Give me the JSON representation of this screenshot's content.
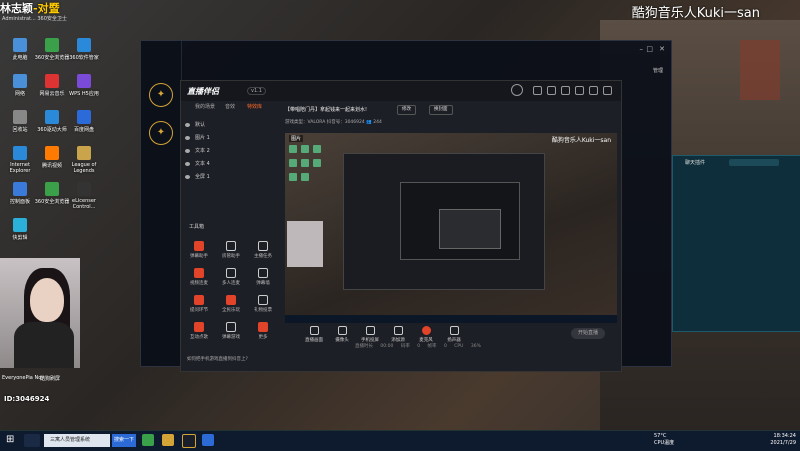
{
  "overlay": {
    "stream_title_prefix": "林志颖",
    "stream_title_suffix": "-对暨",
    "admin_label": "Administrat...  360安全卫士",
    "streamer_name": "酷狗音乐人Kuki一san",
    "stream_id_label": "ID:",
    "stream_id": "3046924"
  },
  "desktop_icons": [
    {
      "label": "此电脑",
      "color": "#4a90d9"
    },
    {
      "label": "360安全浏览器",
      "color": "#3aa04a"
    },
    {
      "label": "360软件管家",
      "color": "#2a8ad9"
    },
    {
      "label": "网络",
      "color": "#4a90d9"
    },
    {
      "label": "网易云音乐",
      "color": "#d33"
    },
    {
      "label": "WPS H5应用",
      "color": "#7a4ad9"
    },
    {
      "label": "回收站",
      "color": "#888"
    },
    {
      "label": "360驱动大师",
      "color": "#2a8ad9"
    },
    {
      "label": "百度网盘",
      "color": "#2a6ad9"
    },
    {
      "label": "Internet Explorer",
      "color": "#2a8ad9"
    },
    {
      "label": "腾讯视频",
      "color": "#ff7a00"
    },
    {
      "label": "League of Legends",
      "color": "#c9a44a"
    },
    {
      "label": "控制面板",
      "color": "#3a7ad9"
    },
    {
      "label": "360安全浏览器",
      "color": "#3aa04a"
    },
    {
      "label": "eLicenser Control...",
      "color": "#333"
    },
    {
      "label": "快剪辑",
      "color": "#2ab0d9"
    }
  ],
  "webcam_labels": [
    "EveryonePia No",
    "酷狗刷屏"
  ],
  "taskbar": {
    "task_label": "三寓人员管理系统",
    "search_label": "搜索一下",
    "temp": "57°C",
    "temp_sub": "CPU温度",
    "time": "18:34:24",
    "date": "2021/7/29"
  },
  "main_window": {
    "controls": [
      "–",
      "□",
      "✕"
    ],
    "user_label": "管理"
  },
  "app": {
    "logo": "直播伴侣",
    "version": "v1.1",
    "tabs": [
      "我的场景",
      "音效",
      "特效库"
    ],
    "active_tab_index": 2,
    "scenes": [
      "默认",
      "图片 1",
      "文本 2",
      "文本 4",
      "全屏 1"
    ],
    "tools_label": "工具箱",
    "tools": [
      {
        "label": "弹幕助手",
        "hot": true
      },
      {
        "label": "房管助手",
        "hot": false
      },
      {
        "label": "主播任务",
        "hot": false
      },
      {
        "label": "视频连麦",
        "hot": true
      },
      {
        "label": "多人连麦",
        "hot": false
      },
      {
        "label": "弹幕墙",
        "hot": false
      },
      {
        "label": "提问环节",
        "hot": true
      },
      {
        "label": "全民乐玩",
        "hot": true
      },
      {
        "label": "礼物投票",
        "hot": false
      },
      {
        "label": "互动点歌",
        "hot": true
      },
      {
        "label": "弹幕游戏",
        "hot": false
      },
      {
        "label": "更多",
        "hot": true
      }
    ],
    "bottom_note": "如何把手机游戏直播到抖音上?",
    "room_title": "【带唱陪门丹】拿起钱来一起来划水!",
    "room_btn_edit": "修改",
    "room_btn_switch": "换封面",
    "room_sub": "游戏类型：VALORA   抖音号：3046924   👥 244",
    "preview_tag": "图片",
    "preview_name": "酷狗音乐人Kuki一san",
    "controls": [
      {
        "label": "直播画面",
        "mic": false
      },
      {
        "label": "摄像头",
        "mic": false
      },
      {
        "label": "手机投屏",
        "mic": false
      },
      {
        "label": "添加源",
        "mic": false
      },
      {
        "label": "麦克风",
        "mic": true
      },
      {
        "label": "扬声器",
        "mic": false
      }
    ],
    "start_live": "开始直播",
    "stats": "直播时长  00:00  码率  0  帧率  0  CPU  36%"
  },
  "chat": {
    "title": "聊天插件"
  }
}
